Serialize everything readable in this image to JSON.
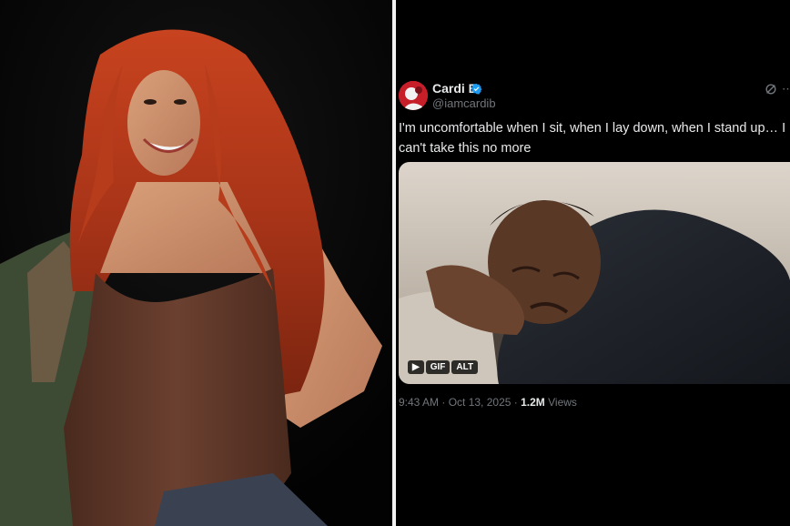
{
  "tweet": {
    "display_name": "Cardi B",
    "handle": "@iamcardib",
    "text": "I'm uncomfortable when I sit, when I lay down, when I stand up… I can't take this no more",
    "media": {
      "play_label": "▶",
      "gif_label": "GIF",
      "alt_label": "ALT"
    },
    "time": "9:43 AM",
    "separator": " · ",
    "date": "Oct 13, 2025",
    "views_count": "1.2M",
    "views_label": " Views"
  },
  "colors": {
    "verified": "#1d9bf0",
    "background": "#000000",
    "text": "#e7e9ea",
    "muted": "#71767b"
  },
  "icons": [
    "verified-badge-icon",
    "grok-icon",
    "more-icon",
    "play-icon"
  ]
}
